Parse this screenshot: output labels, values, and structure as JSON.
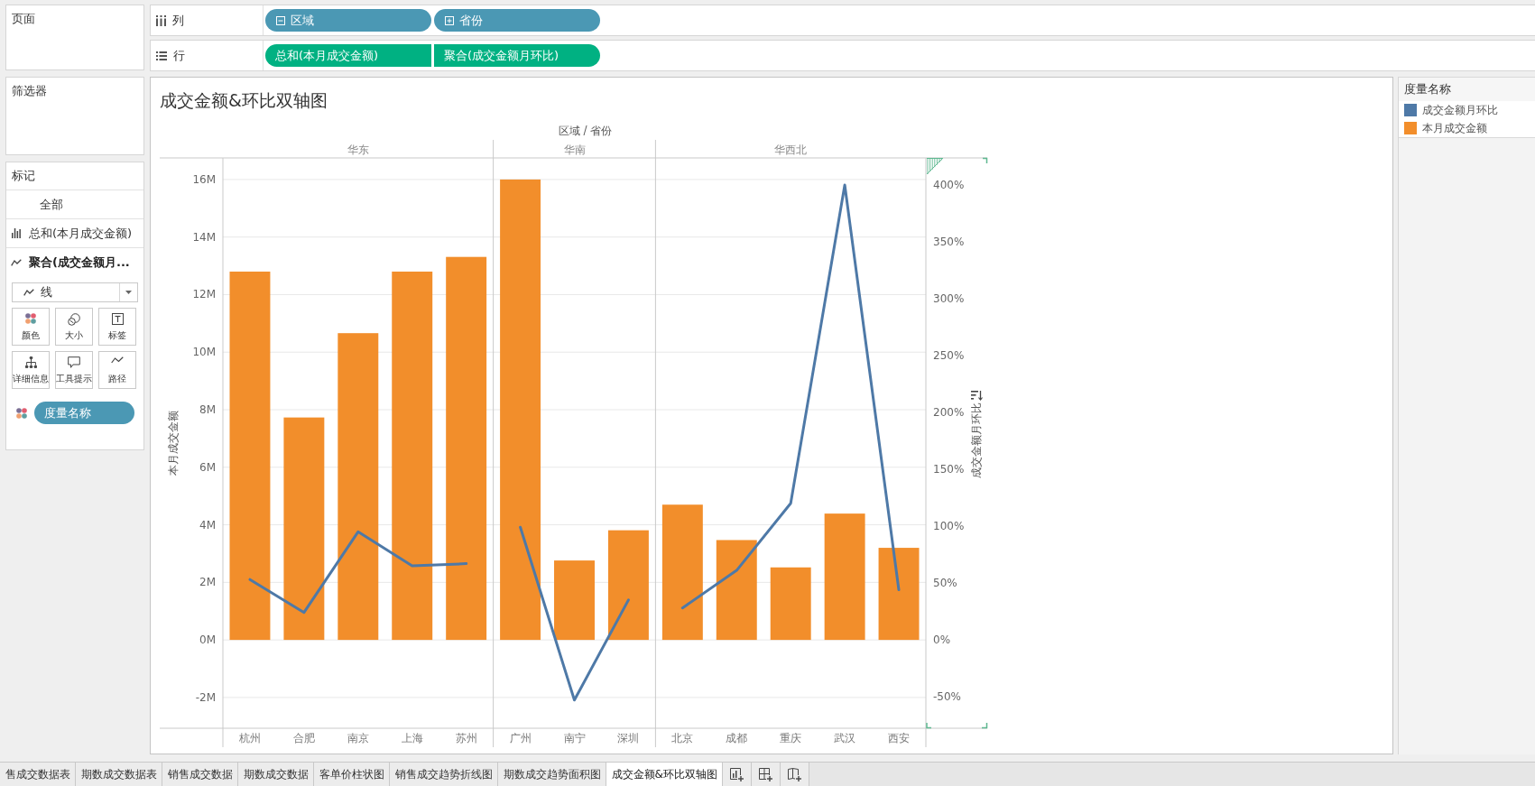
{
  "side_panels": {
    "pages": {
      "title": "页面"
    },
    "filters": {
      "title": "筛选器"
    }
  },
  "marks": {
    "title": "标记",
    "cards": [
      {
        "label": "全部",
        "kind": "all",
        "selected": false
      },
      {
        "label": "总和(本月成交金额)",
        "kind": "bar",
        "selected": false
      },
      {
        "label": "聚合(成交金额月...",
        "kind": "line",
        "selected": true
      }
    ],
    "mark_type": {
      "label": "线",
      "kind": "line"
    },
    "properties": [
      {
        "label": "颜色",
        "kind": "color"
      },
      {
        "label": "大小",
        "kind": "size"
      },
      {
        "label": "标签",
        "kind": "label"
      },
      {
        "label": "详细信息",
        "kind": "detail"
      },
      {
        "label": "工具提示",
        "kind": "tooltip"
      },
      {
        "label": "路径",
        "kind": "path"
      }
    ],
    "fields": [
      {
        "label": "度量名称",
        "kind": "color"
      }
    ]
  },
  "shelves": {
    "columns": {
      "label": "列",
      "pills": [
        {
          "label": "区域",
          "kind": "dimension",
          "expanded": true
        },
        {
          "label": "省份",
          "kind": "dimension",
          "expanded": false
        }
      ]
    },
    "rows": {
      "label": "行",
      "pills": [
        {
          "label": "总和(本月成交金额)",
          "kind": "measure"
        },
        {
          "label": "聚合(成交金额月环比)",
          "kind": "measure"
        }
      ]
    }
  },
  "view": {
    "region_headers": [
      {
        "label": "华东"
      },
      {
        "label": "华南"
      },
      {
        "label": "华西北"
      }
    ],
    "chart_data": {
      "type": "bar",
      "title": "成交金额&环比双轴图",
      "xlabel": "区域 / 省份",
      "ylabel": "本月成交金额",
      "y2label": "成交金额月环比",
      "legend": {
        "title": "度量名称"
      },
      "categories": [
        "杭州",
        "合肥",
        "南京",
        "上海",
        "苏州",
        "广州",
        "南宁",
        "深圳",
        "北京",
        "成都",
        "重庆",
        "武汉",
        "西安"
      ],
      "series": [
        {
          "name": "成交金额月环比",
          "type": "line",
          "axis": "y2",
          "color": "#4e79a7",
          "values": [
            53,
            24,
            95,
            65,
            67,
            99,
            -53,
            35,
            28,
            61,
            120,
            400,
            44
          ]
        },
        {
          "name": "本月成交金额",
          "type": "bar",
          "color": "#f28e2b",
          "values": [
            12.8,
            7.73,
            10.66,
            12.8,
            13.31,
            16.0,
            2.76,
            3.81,
            4.7,
            3.47,
            2.52,
            4.39,
            3.2
          ]
        }
      ],
      "ylim": [
        -3.07,
        16.75
      ],
      "yticks": [
        {
          "value": -2,
          "label": "-2M"
        },
        {
          "value": 0,
          "label": "0M"
        },
        {
          "value": 2,
          "label": "2M"
        },
        {
          "value": 4,
          "label": "4M"
        },
        {
          "value": 6,
          "label": "6M"
        },
        {
          "value": 8,
          "label": "8M"
        },
        {
          "value": 10,
          "label": "10M"
        },
        {
          "value": 12,
          "label": "12M"
        },
        {
          "value": 14,
          "label": "14M"
        },
        {
          "value": 16,
          "label": "16M"
        }
      ],
      "y2lim": [
        -77.8,
        423.8
      ],
      "y2ticks": [
        {
          "value": -50,
          "label": "-50%"
        },
        {
          "value": 0,
          "label": "0%"
        },
        {
          "value": 50,
          "label": "50%"
        },
        {
          "value": 100,
          "label": "100%"
        },
        {
          "value": 150,
          "label": "150%"
        },
        {
          "value": 200,
          "label": "200%"
        },
        {
          "value": 250,
          "label": "250%"
        },
        {
          "value": 300,
          "label": "300%"
        },
        {
          "value": 350,
          "label": "350%"
        },
        {
          "value": 400,
          "label": "400%"
        }
      ],
      "grid": true
    }
  },
  "sheet_tabs": [
    {
      "label": "售成交数据表",
      "selected": false
    },
    {
      "label": "期数成交数据表",
      "selected": false
    },
    {
      "label": "销售成交数据",
      "selected": false
    },
    {
      "label": "期数成交数据",
      "selected": false
    },
    {
      "label": "客单价柱状图",
      "selected": false
    },
    {
      "label": "销售成交趋势折线图",
      "selected": false
    },
    {
      "label": "期数成交趋势面积图",
      "selected": false
    },
    {
      "label": "成交金额&环比双轴图",
      "selected": true
    }
  ]
}
